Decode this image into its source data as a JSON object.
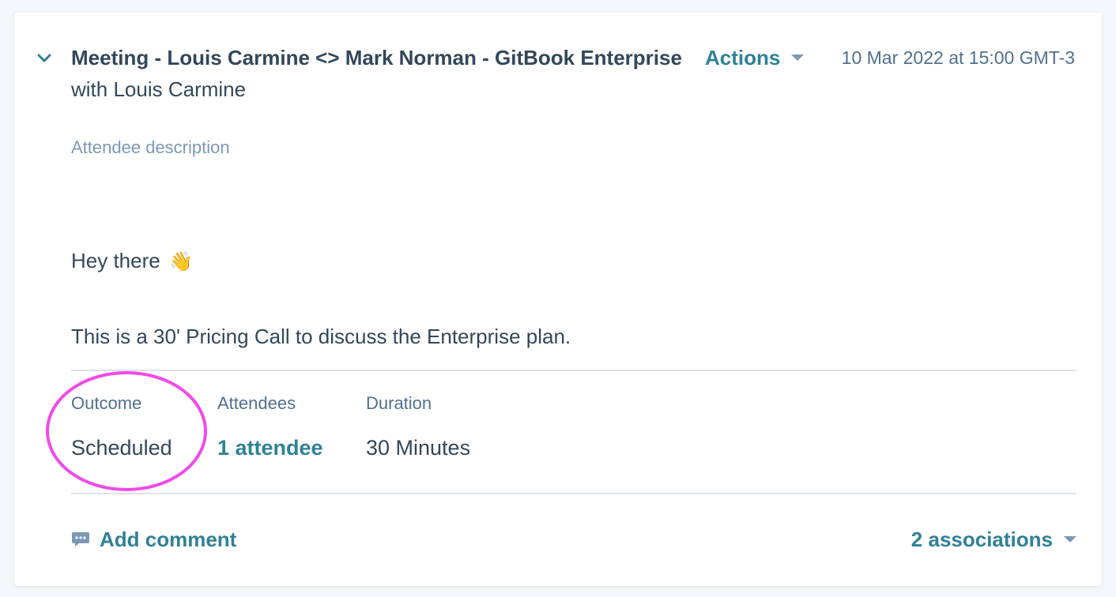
{
  "meeting": {
    "title": "Meeting - Louis Carmine <> Mark Norman - GitBook Enterprise",
    "actions_label": "Actions",
    "timestamp": "10 Mar 2022 at 15:00 GMT-3",
    "subtitle": "with Louis Carmine",
    "attendee_description_label": "Attendee description",
    "body": {
      "greeting": "Hey there",
      "greeting_emoji": "👋",
      "description": "This is a 30' Pricing Call to discuss the Enterprise plan."
    }
  },
  "fields": {
    "outcome": {
      "label": "Outcome",
      "value": "Scheduled"
    },
    "attendees": {
      "label": "Attendees",
      "value": "1 attendee"
    },
    "duration": {
      "label": "Duration",
      "value": "30 Minutes"
    }
  },
  "footer": {
    "add_comment_label": "Add comment",
    "associations_label": "2 associations"
  },
  "icons": {
    "expand": "chevron-down-icon",
    "actions_caret": "caret-down-icon",
    "comment": "comment-icon",
    "associations_caret": "caret-down-icon"
  },
  "colors": {
    "accent": "#2f8196",
    "text": "#33475b",
    "muted": "#7c98b6",
    "highlight": "#f04be8"
  }
}
